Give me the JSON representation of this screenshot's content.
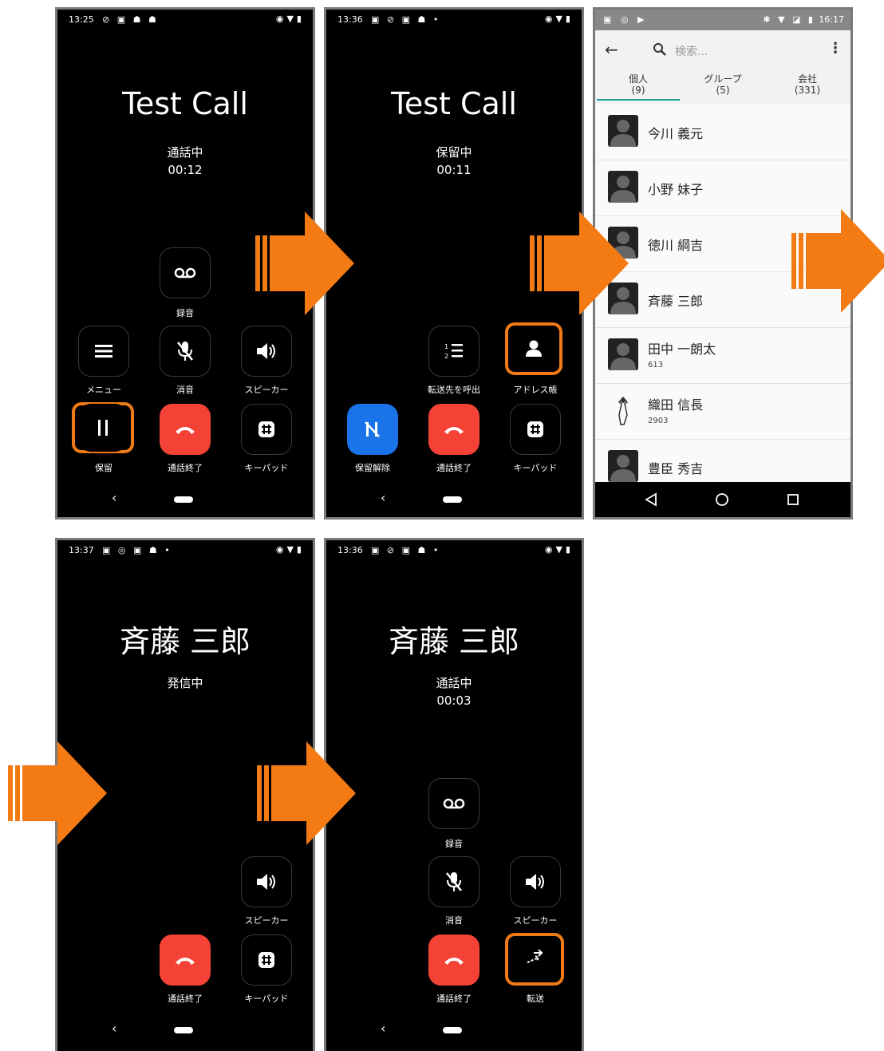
{
  "colors": {
    "accent": "#f07a17",
    "end_call": "#f44336",
    "unhold": "#1a73e8"
  },
  "screen1": {
    "time": "13:25",
    "title": "Test Call",
    "status": "通話中",
    "duration": "00:12",
    "record": "録音",
    "menu": "メニュー",
    "mute": "消音",
    "speaker": "スピーカー",
    "hold": "保留",
    "end": "通話終了",
    "keypad": "キーパッド",
    "back": "‹"
  },
  "screen2": {
    "time": "13:36",
    "title": "Test Call",
    "status": "保留中",
    "duration": "00:11",
    "call_transfer": "転送先を呼出",
    "address_book": "アドレス帳",
    "unhold": "保留解除",
    "end": "通話終了",
    "keypad": "キーパッド",
    "back": "‹"
  },
  "screen3": {
    "time": "16:17",
    "search_placeholder": "検索...",
    "tabs": [
      {
        "label": "個人",
        "count": "(9)"
      },
      {
        "label": "グループ",
        "count": "(5)"
      },
      {
        "label": "会社",
        "count": "(331)"
      }
    ],
    "contacts": [
      {
        "name": "今川 義元",
        "sub": ""
      },
      {
        "name": "小野 妹子",
        "sub": ""
      },
      {
        "name": "徳川 綱吉",
        "sub": ""
      },
      {
        "name": "斉藤 三郎",
        "sub": ""
      },
      {
        "name": "田中 一朗太",
        "sub": "613"
      },
      {
        "name": "織田 信長",
        "sub": "2903"
      },
      {
        "name": "豊臣 秀吉",
        "sub": ""
      }
    ]
  },
  "screen4": {
    "time": "13:37",
    "title": "斉藤 三郎",
    "status": "発信中",
    "speaker": "スピーカー",
    "end": "通話終了",
    "keypad": "キーパッド",
    "back": "‹"
  },
  "screen5": {
    "time": "13:36",
    "title": "斉藤 三郎",
    "status": "通話中",
    "duration": "00:03",
    "record": "録音",
    "mute": "消音",
    "speaker": "スピーカー",
    "end": "通話終了",
    "transfer": "転送",
    "back": "‹"
  }
}
